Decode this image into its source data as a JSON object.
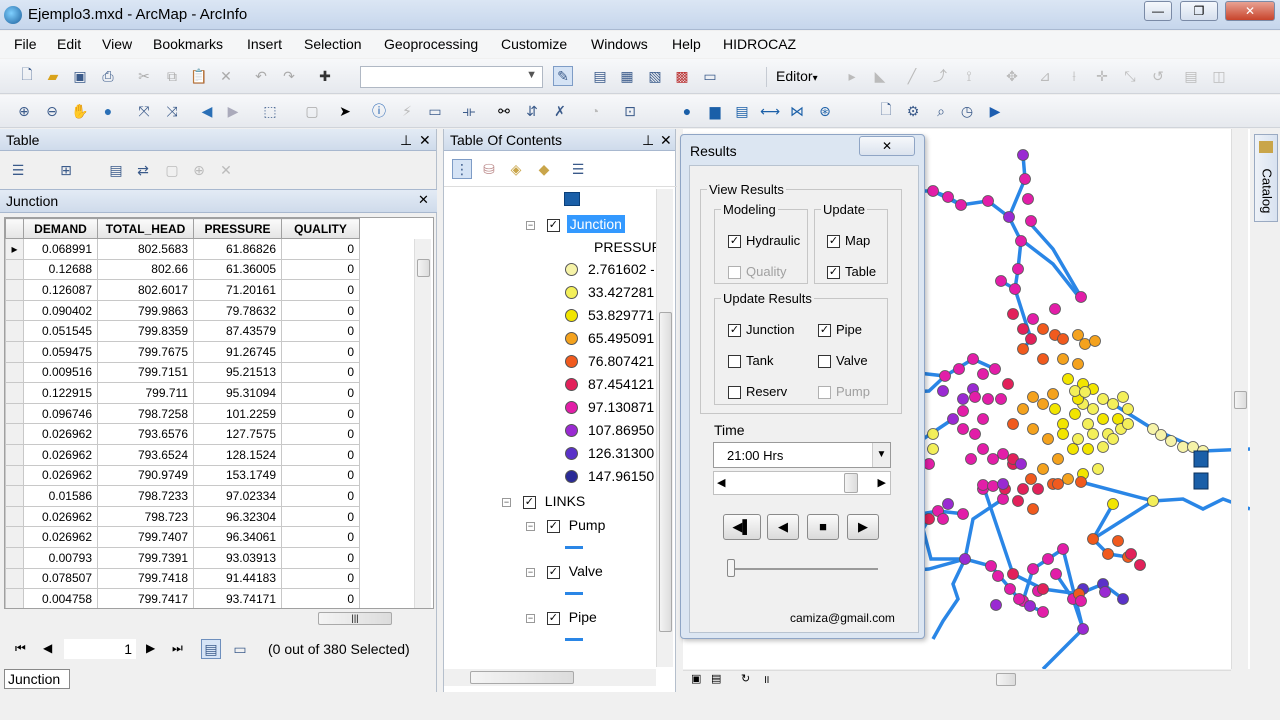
{
  "window": {
    "title": "Ejemplo3.mxd - ArcMap - ArcInfo"
  },
  "menu": [
    "File",
    "Edit",
    "View",
    "Bookmarks",
    "Insert",
    "Selection",
    "Geoprocessing",
    "Customize",
    "Windows",
    "Help",
    "HIDROCAZ"
  ],
  "toolbar": {
    "editor_label": "Editor",
    "editor_arrow": "▾"
  },
  "table_panel": {
    "title": "Table",
    "layer_tab": "Junction",
    "columns": [
      "DEMAND",
      "TOTAL_HEAD",
      "PRESSURE",
      "QUALITY"
    ],
    "rows": [
      [
        "0.068991",
        "802.5683",
        "61.86826",
        "0"
      ],
      [
        "0.12688",
        "802.66",
        "61.36005",
        "0"
      ],
      [
        "0.126087",
        "802.6017",
        "71.20161",
        "0"
      ],
      [
        "0.090402",
        "799.9863",
        "79.78632",
        "0"
      ],
      [
        "0.051545",
        "799.8359",
        "87.43579",
        "0"
      ],
      [
        "0.059475",
        "799.7675",
        "91.26745",
        "0"
      ],
      [
        "0.009516",
        "799.7151",
        "95.21513",
        "0"
      ],
      [
        "0.122915",
        "799.711",
        "95.31094",
        "0"
      ],
      [
        "0.096746",
        "798.7258",
        "101.2259",
        "0"
      ],
      [
        "0.026962",
        "793.6576",
        "127.7575",
        "0"
      ],
      [
        "0.026962",
        "793.6524",
        "128.1524",
        "0"
      ],
      [
        "0.026962",
        "790.9749",
        "153.1749",
        "0"
      ],
      [
        "0.01586",
        "798.7233",
        "97.02334",
        "0"
      ],
      [
        "0.026962",
        "798.723",
        "96.32304",
        "0"
      ],
      [
        "0.026962",
        "799.7407",
        "96.34061",
        "0"
      ],
      [
        "0.00793",
        "799.7391",
        "93.03913",
        "0"
      ],
      [
        "0.078507",
        "799.7418",
        "91.44183",
        "0"
      ],
      [
        "0.004758",
        "799.7417",
        "93.74171",
        "0"
      ]
    ],
    "current_record": "1",
    "selection_status": "(0 out of 380 Selected)",
    "bottom_tab": "Junction"
  },
  "toc": {
    "title": "Table Of Contents",
    "junction_layer": "Junction",
    "field_label": "PRESSUR",
    "classes": [
      {
        "label": "2.761602 -",
        "color": "#f6f3a8"
      },
      {
        "label": "33.427281",
        "color": "#f3ef5a"
      },
      {
        "label": "53.829771",
        "color": "#f2e500"
      },
      {
        "label": "65.495091",
        "color": "#f4a21e"
      },
      {
        "label": "76.807421",
        "color": "#f05a1e"
      },
      {
        "label": "87.454121",
        "color": "#e2215a"
      },
      {
        "label": "97.130871",
        "color": "#e21ea8"
      },
      {
        "label": "107.86950",
        "color": "#9a2ad2"
      },
      {
        "label": "126.31300",
        "color": "#5a32c8"
      },
      {
        "label": "147.96150",
        "color": "#2a2a96"
      }
    ],
    "links_group": "LINKS",
    "link_layers": [
      "Pump",
      "Valve",
      "Pipe"
    ]
  },
  "results": {
    "title": "Results",
    "view_results": "View Results",
    "modeling": "Modeling",
    "update": "Update",
    "hydraulic": "Hydraulic",
    "quality": "Quality",
    "map": "Map",
    "table": "Table",
    "update_results": "Update Results",
    "junction": "Junction",
    "pipe": "Pipe",
    "tank": "Tank",
    "valve": "Valve",
    "reserv": "Reserv",
    "pump": "Pump",
    "time_label": "Time",
    "time_value": "21:00 Hrs",
    "footer": "camiza@gmail.com"
  },
  "catalog_tab": "Catalog",
  "colors": {
    "pipe": "#2a86e6",
    "titlebar": "#c6d6ec"
  }
}
